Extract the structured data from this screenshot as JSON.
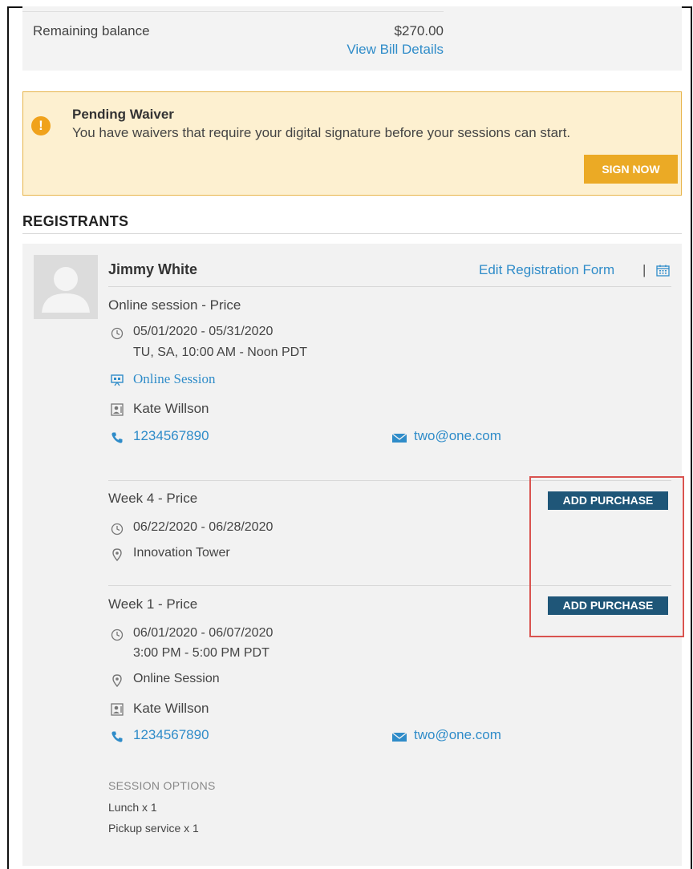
{
  "summary": {
    "remaining_label": "Remaining balance",
    "remaining_amount": "$270.00",
    "view_bill_link": "View Bill Details"
  },
  "waiver": {
    "icon": "exclamation-icon",
    "title": "Pending Waiver",
    "message": "You have waivers that require your digital signature before your sessions can start.",
    "button": "SIGN NOW"
  },
  "registrants": {
    "heading": "REGISTRANTS",
    "registrant": {
      "name": "Jimmy White",
      "edit_link": "Edit Registration Form",
      "separator": "|",
      "sessions": [
        {
          "title": "Online session - Price",
          "dates": "05/01/2020 - 05/31/2020",
          "times": "TU, SA, 10:00 AM - Noon PDT",
          "location": "Online Session",
          "instructor": "Kate Willson",
          "phone": "1234567890",
          "email": "two@one.com"
        },
        {
          "title": "Week 4 - Price",
          "dates": "06/22/2020 - 06/28/2020",
          "location": "Innovation Tower",
          "button": "ADD PURCHASE"
        },
        {
          "title": "Week 1 - Price",
          "dates": "06/01/2020 - 06/07/2020",
          "times": "3:00 PM - 5:00 PM PDT",
          "location": "Online Session",
          "instructor": "Kate Willson",
          "phone": "1234567890",
          "email": "two@one.com",
          "button": "ADD PURCHASE"
        }
      ],
      "session_options": {
        "heading": "SESSION OPTIONS",
        "items": [
          "Lunch  x 1",
          "Pickup service  x 1"
        ]
      }
    }
  },
  "colors": {
    "link": "#2f8cc9",
    "button_primary": "#1f5678",
    "sign_button": "#ebaa25",
    "waiver_bg": "#fdf0d0",
    "highlight_box": "#d9534f"
  }
}
